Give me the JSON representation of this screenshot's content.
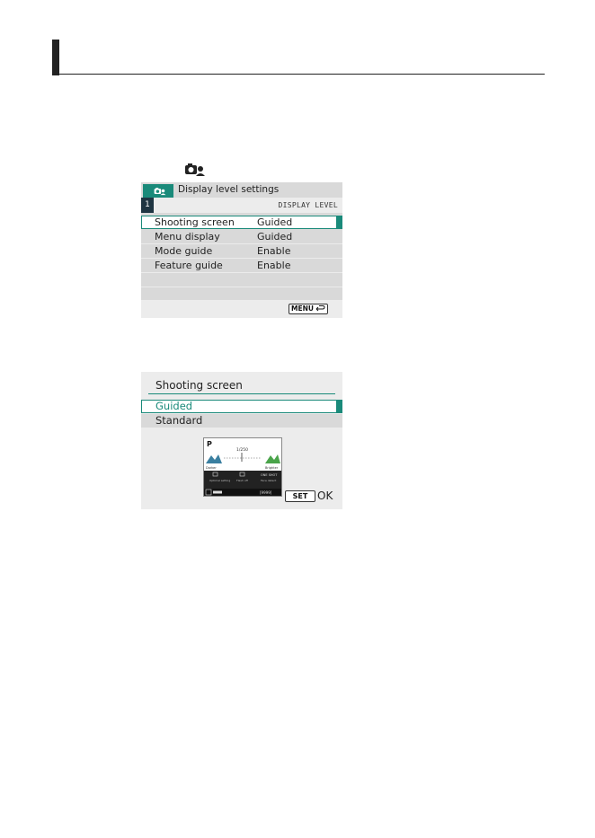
{
  "screen1": {
    "title": "Display level settings",
    "page_number": "1",
    "header_label": "DISPLAY LEVEL",
    "rows": [
      {
        "label": "Shooting screen",
        "value": "Guided",
        "selected": true
      },
      {
        "label": "Menu display",
        "value": "Guided",
        "selected": false
      },
      {
        "label": "Mode guide",
        "value": "Enable",
        "selected": false
      },
      {
        "label": "Feature guide",
        "value": "Enable",
        "selected": false
      }
    ],
    "menu_button_label": "MENU",
    "accent_color": "#1a8a7a"
  },
  "screen2": {
    "title": "Shooting screen",
    "options": [
      {
        "label": "Guided",
        "selected": true
      },
      {
        "label": "Standard",
        "selected": false
      }
    ],
    "preview": {
      "mode": "P",
      "left_caption": "Darker",
      "right_caption": "Brighter",
      "scale_value": "1/250",
      "bottom_labels": [
        "Optimal setting",
        "Flash off",
        "Face detect"
      ]
    },
    "set_label": "SET",
    "ok_label": "OK"
  },
  "icons": {
    "camera_person": "camera-person-icon",
    "return": "return-arrow-icon"
  }
}
